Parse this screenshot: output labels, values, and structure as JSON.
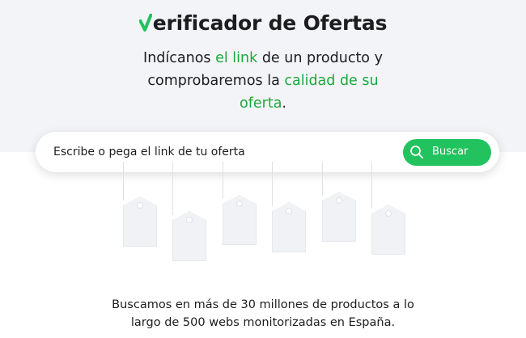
{
  "brand": {
    "title_first_letter": "V",
    "title_rest": "erificador de Ofertas",
    "check_icon": "green-check-v-icon",
    "accent_color": "#22c35e"
  },
  "tagline": {
    "part1": "Indícanos ",
    "highlight1": "el link",
    "part2": " de un producto y",
    "part3": "comprobaremos la ",
    "highlight2": "calidad de su",
    "highlight3": "oferta",
    "part4": "."
  },
  "search": {
    "placeholder": "Escribe o pega el link de tu oferta",
    "button_label": "Buscar",
    "button_icon": "search-icon"
  },
  "footer": {
    "line1": "Buscamos en más de 30 millones de productos a lo",
    "line2": "largo de 500 webs monitorizadas en España."
  }
}
